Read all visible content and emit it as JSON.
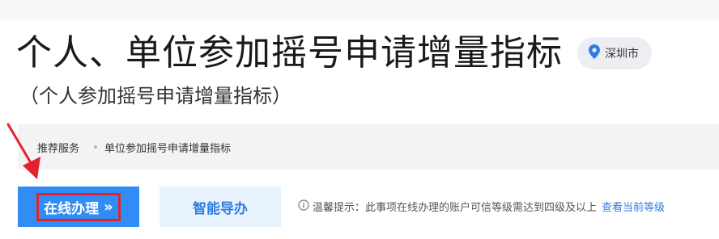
{
  "page": {
    "title": "个人、单位参加摇号申请增量指标",
    "location": "深圳市",
    "subtitle": "（个人参加摇号申请增量指标）"
  },
  "breadcrumb": {
    "items": [
      "推荐服务",
      "单位参加摇号申请增量指标"
    ]
  },
  "actions": {
    "online_label": "在线办理",
    "online_chevron": "»",
    "guide_label": "智能导办"
  },
  "notice": {
    "text": "温馨提示：此事项在线办理的账户可信等级需达到四级及以上",
    "link": "查看当前等级"
  },
  "colors": {
    "primary": "#2f8df5",
    "link": "#2f7fe0",
    "highlight": "#e5222b",
    "guide_bg": "#e9f3fd"
  },
  "icons": {
    "location": "location-pin-icon",
    "info": "info-circle-icon",
    "chevron": "double-chevron-right-icon",
    "annotation": "red-arrow-annotation"
  }
}
